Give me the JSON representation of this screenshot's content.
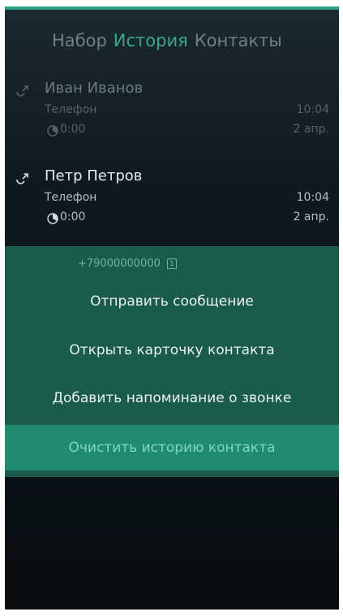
{
  "tabs": [
    {
      "label": "Набор"
    },
    {
      "label": "История"
    },
    {
      "label": "Контакты"
    }
  ],
  "calls": [
    {
      "name": "Иван Иванов",
      "type": "Телефон",
      "time": "10:04",
      "duration": "0:00",
      "date": "2 апр."
    },
    {
      "name": "Петр Петров",
      "type": "Телефон",
      "time": "10:04",
      "duration": "0:00",
      "date": "2 апр."
    }
  ],
  "context_menu": {
    "number": "+79000000000",
    "sim_slot": "1",
    "items": [
      {
        "label": "Отправить сообщение"
      },
      {
        "label": "Открыть карточку контакта"
      },
      {
        "label": "Добавить напоминание о звонке"
      },
      {
        "label": "Очистить историю контакта"
      }
    ]
  },
  "colors": {
    "accent": "#2a9f86",
    "menu_bg": "#1a5b4c",
    "highlight_bg": "#218b71"
  }
}
